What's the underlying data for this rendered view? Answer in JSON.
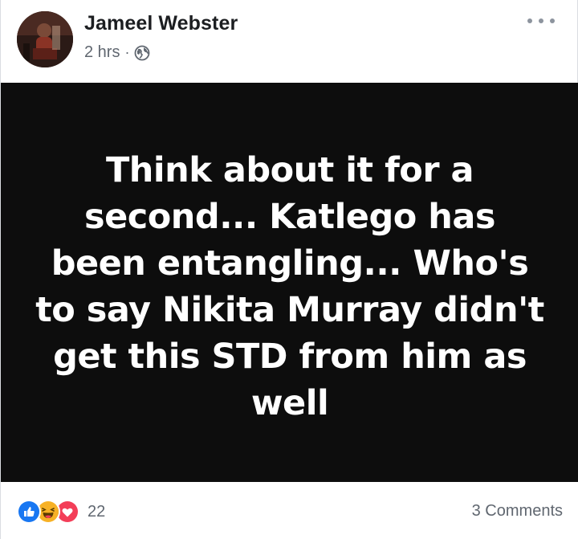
{
  "post": {
    "author": "Jameel Webster",
    "timestamp": "2 hrs",
    "separator": "·",
    "privacy_icon": "globe-icon",
    "image_text": "Think about it for a second... Katlego has been entangling... Who's to say Nikita Murray didn't get this STD from him as well",
    "image_background": "#0d0d0d"
  },
  "footer": {
    "reactions": [
      "like-icon",
      "haha-icon",
      "love-icon"
    ],
    "reaction_count": "22",
    "comments": "3 Comments"
  },
  "colors": {
    "like": "#1877f2",
    "haha": "#f7b125",
    "love": "#f33e58",
    "secondary_text": "#606770"
  }
}
